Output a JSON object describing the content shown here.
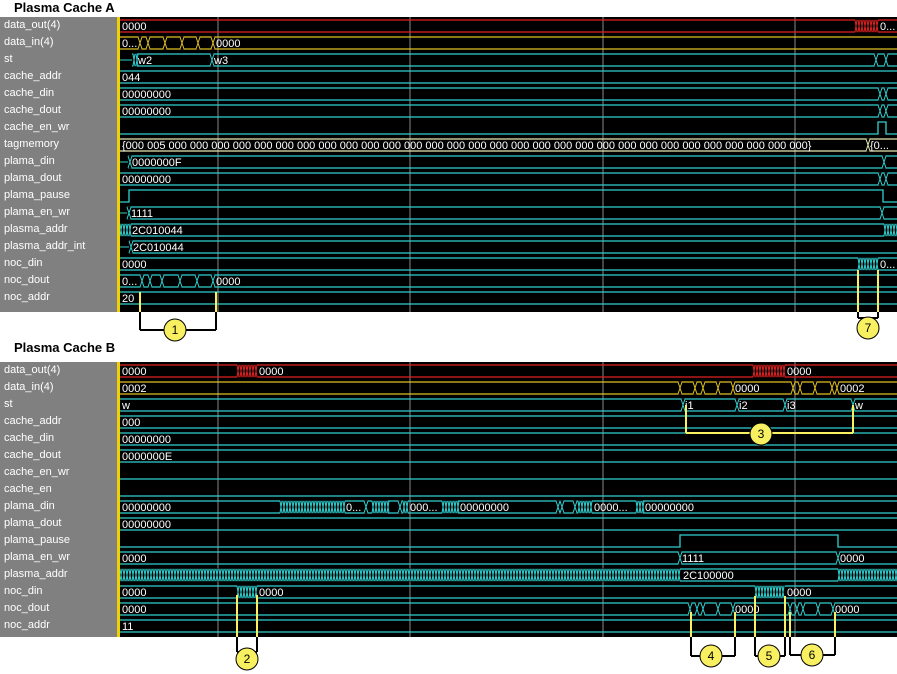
{
  "panels": [
    {
      "title": "Plasma Cache A",
      "signals": [
        {
          "name": "data_out(4)",
          "values": [
            "0000",
            "0..."
          ]
        },
        {
          "name": "data_in(4)",
          "values": [
            "0...",
            "0000"
          ]
        },
        {
          "name": "st",
          "values": [
            "w2",
            "w3"
          ]
        },
        {
          "name": "cache_addr",
          "values": [
            "044"
          ]
        },
        {
          "name": "cache_din",
          "values": [
            "00000000"
          ]
        },
        {
          "name": "cache_dout",
          "values": [
            "00000000"
          ]
        },
        {
          "name": "cache_en_wr",
          "values": []
        },
        {
          "name": "tagmemory",
          "values": [
            "{000 005 000 000 000 000 000 000 000 000 000 000 000 000 000 000 000 000 000 000 000 000 000 000 000 000 000 000 000 000 000 000}",
            "{0..."
          ]
        },
        {
          "name": "plama_din",
          "values": [
            "0000000F"
          ]
        },
        {
          "name": "plama_dout",
          "values": [
            "00000000"
          ]
        },
        {
          "name": "plama_pause",
          "values": []
        },
        {
          "name": "plama_en_wr",
          "values": [
            "1111"
          ]
        },
        {
          "name": "plasma_addr",
          "values": [
            "2C010044"
          ]
        },
        {
          "name": "plasma_addr_int",
          "values": [
            "2C010044"
          ]
        },
        {
          "name": "noc_din",
          "values": [
            "0000",
            "0..."
          ]
        },
        {
          "name": "noc_dout",
          "values": [
            "0...",
            "0000"
          ]
        },
        {
          "name": "noc_addr",
          "values": [
            "20"
          ]
        }
      ],
      "markers": [
        "1",
        "7"
      ]
    },
    {
      "title": "Plasma Cache B",
      "signals": [
        {
          "name": "data_out(4)",
          "values": [
            "0000",
            "0000",
            "0000"
          ]
        },
        {
          "name": "data_in(4)",
          "values": [
            "0002",
            "0000",
            "0002"
          ]
        },
        {
          "name": "st",
          "values": [
            "w",
            "i1",
            "i2",
            "i3",
            "w"
          ]
        },
        {
          "name": "cache_addr",
          "values": [
            "000"
          ]
        },
        {
          "name": "cache_din",
          "values": [
            "00000000"
          ]
        },
        {
          "name": "cache_dout",
          "values": [
            "0000000E"
          ]
        },
        {
          "name": "cache_en_wr",
          "values": []
        },
        {
          "name": "cache_en",
          "values": []
        },
        {
          "name": "plama_din",
          "values": [
            "00000000",
            "0...",
            "000...",
            "00000000",
            "0000...",
            "00000000"
          ]
        },
        {
          "name": "plama_dout",
          "values": [
            "00000000"
          ]
        },
        {
          "name": "plama_pause",
          "values": []
        },
        {
          "name": "plama_en_wr",
          "values": [
            "0000",
            "1111",
            "0000"
          ]
        },
        {
          "name": "plasma_addr",
          "values": [
            "2C100000"
          ]
        },
        {
          "name": "noc_din",
          "values": [
            "0000",
            "0000",
            "0000"
          ]
        },
        {
          "name": "noc_dout",
          "values": [
            "0000",
            "0000",
            "0000"
          ]
        },
        {
          "name": "noc_addr",
          "values": [
            "11"
          ]
        }
      ],
      "markers": [
        "2",
        "3",
        "4",
        "5",
        "6"
      ]
    }
  ],
  "colors": {
    "bus": "#30d0d0",
    "data_out": "#e02020",
    "data_in": "#e0c020",
    "tag": "#e8e8b0",
    "marker": "#f8f060",
    "background": "#000000",
    "label_panel": "#808080"
  }
}
